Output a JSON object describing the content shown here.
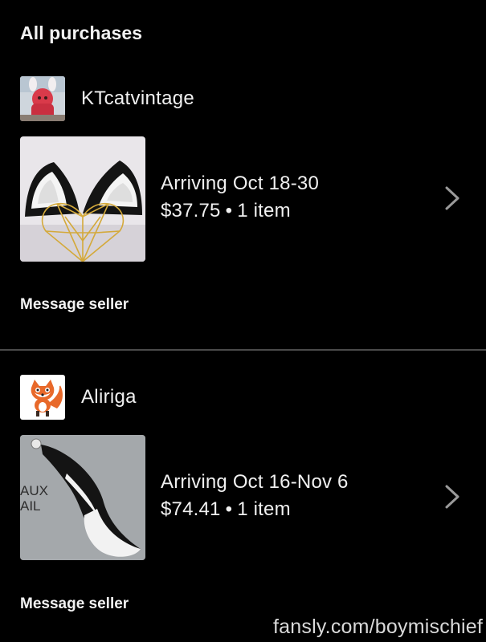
{
  "section": {
    "title": "All purchases"
  },
  "orders": [
    {
      "shop_name": "KTcatvintage",
      "arrival": "Arriving Oct 18-30",
      "price": "$37.75",
      "separator": "•",
      "item_count": "1 item",
      "message_label": "Message seller",
      "thumb_icon": "cat-ears-headband-image",
      "avatar_icon": "shop-avatar-photo"
    },
    {
      "shop_name": "Aliriga",
      "arrival": "Arriving Oct 16-Nov 6",
      "price": "$74.41",
      "separator": "•",
      "item_count": "1 item",
      "message_label": "Message seller",
      "thumb_icon": "faux-tail-image",
      "thumb_text_1": "AUX",
      "thumb_text_2": "AIL",
      "avatar_icon": "fox-avatar"
    }
  ],
  "watermark": "fansly.com/boymischief",
  "colors": {
    "background": "#000000",
    "text": "#f0f0f0",
    "divider": "#4a4a4a",
    "chevron": "#9a9a9a"
  }
}
